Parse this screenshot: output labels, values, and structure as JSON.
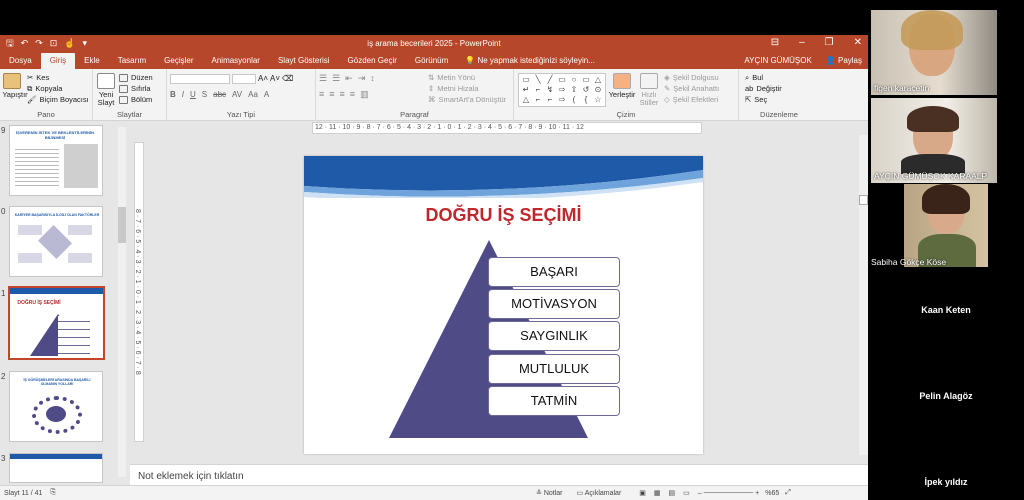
{
  "app": {
    "doc_title": "iş arama becerileri 2025 - PowerPoint",
    "user": "AYÇIN GÜMÜŞOK",
    "share_label": "Paylaş"
  },
  "tabs": [
    "Dosya",
    "Giriş",
    "Ekle",
    "Tasarım",
    "Geçişler",
    "Animasyonlar",
    "Slayt Gösterisi",
    "Gözden Geçir",
    "Görünüm"
  ],
  "tell_me": "Ne yapmak istediğinizi söyleyin...",
  "ribbon": {
    "pano": {
      "label": "Pano",
      "paste": "Yapıştır",
      "cut": "Kes",
      "copy": "Kopyala",
      "format": "Biçim Boyacısı"
    },
    "slaytlar": {
      "label": "Slaytlar",
      "new": "Yeni Slayt",
      "layout": "Düzen",
      "reset": "Sıfırla",
      "section": "Bölüm"
    },
    "yazi_tipi": {
      "label": "Yazı Tipi",
      "bold": "B",
      "italic": "I",
      "underline": "U",
      "shadow": "S",
      "strike": "abc",
      "spacing": "AV",
      "case": "Aa",
      "color": "A"
    },
    "paragraf": {
      "label": "Paragraf",
      "text_dir": "Metin Yönü",
      "align_text": "Metni Hizala",
      "smartart": "SmartArt'a Dönüştür"
    },
    "cizim": {
      "label": "Çizim",
      "arrange": "Yerleştir",
      "quick_styles": "Hızlı Stiller",
      "fill": "Şekil Dolgusu",
      "outline": "Şekil Anahattı",
      "effects": "Şekil Efektleri"
    },
    "duzenleme": {
      "label": "Düzenleme",
      "find": "Bul",
      "replace": "Değiştir",
      "select": "Seç"
    }
  },
  "shape_glyphs": [
    "▭",
    "╲",
    "╱",
    "▭",
    "○",
    "▭",
    "△",
    "↵",
    "⌐",
    "↯",
    "⇨",
    "⇧",
    "↺",
    "⊙",
    "△",
    "⌐",
    "⌐",
    "⇨",
    "(",
    "{",
    "☆"
  ],
  "thumbnails": [
    {
      "num": "9",
      "title": "İŞVERENİN İSTEK VE BEKLENTİLERİNİN BİLİNMESİ"
    },
    {
      "num": "0",
      "title": "KARİYER BAŞARISIYLA İLGİLİ OLAN FAKTÖRLER"
    },
    {
      "num": "1",
      "title": "DOĞRU İŞ SEÇİMİ"
    },
    {
      "num": "2",
      "title": "İŞ GÖRÜŞMELERİ ARASINDA BAŞARILI OLMANIN YOLLARI"
    },
    {
      "num": "3",
      "title": ""
    }
  ],
  "slide": {
    "title": "DOĞRU İŞ SEÇİMİ",
    "levels": [
      "BAŞARI",
      "MOTİVASYON",
      "SAYGINLIK",
      "MUTLULUK",
      "TATMİN"
    ]
  },
  "rulers": {
    "h": "12 · 11 · 10 · 9 · 8 · 7 · 6 · 5 · 4 · 3 · 2 · 1 · 0 · 1 · 2 · 3 · 4 · 5 · 6 · 7 · 8 · 9 · 10 · 11 · 12",
    "v": "8 · 7 · 6 · 5 · 4 · 3 · 2 · 1 · 0 · 1 · 2 · 3 · 4 · 5 · 6 · 7 · 8"
  },
  "notes_placeholder": "Not eklemek için tıklatın",
  "status": {
    "slide_counter": "Slayt 11 / 41",
    "notes": "Notlar",
    "comments": "Açıklamalar",
    "zoom": "%65"
  },
  "participants": [
    {
      "name": "figen karaçetin",
      "has_video": true
    },
    {
      "name": "AYÇIN GÜMÜŞOK KARAALP",
      "has_video": true
    },
    {
      "name": "Sabiha Gökçe Köse",
      "has_video": true
    },
    {
      "name": "Kaan Keten",
      "has_video": false
    },
    {
      "name": "Pelin Alagöz",
      "has_video": false
    },
    {
      "name": "İpek yıldız",
      "has_video": false
    }
  ],
  "colors": {
    "accent": "#b7472a",
    "slide_title": "#c0272d",
    "pyramid": "#4f4b87",
    "slide_band": "#1f5aa8"
  }
}
